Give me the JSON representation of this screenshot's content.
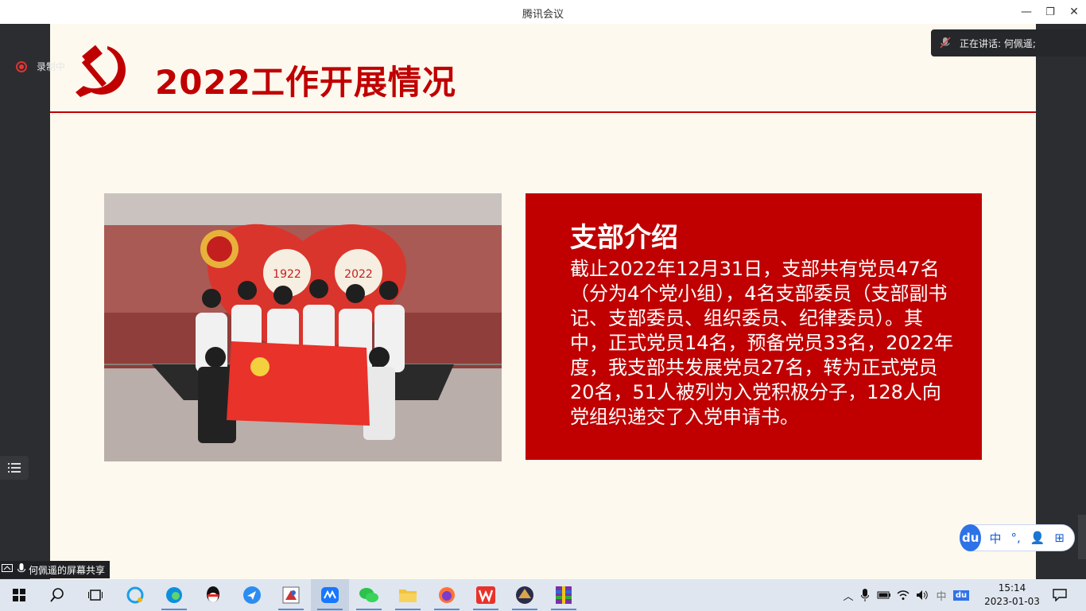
{
  "window": {
    "title": "腾讯会议",
    "minimize": "—",
    "restore": "❐",
    "close": "✕"
  },
  "meeting": {
    "recording": "录制中",
    "speaking": "正在讲话: 何佩遥;",
    "share_label": "何佩遥的屏幕共享"
  },
  "slide": {
    "title": "2022工作开展情况",
    "photo_years": [
      "1922",
      "2022"
    ],
    "info": {
      "heading": "支部介绍",
      "body": "截止2022年12月31日，支部共有党员47名（分为4个党小组），4名支部委员（支部副书记、支部委员、组织委员、纪律委员）。其中，正式党员14名，预备党员33名，2022年度，我支部共发展党员27名，转为正式党员20名，51人被列为入党积极分子，128人向党组织递交了入党申请书。"
    }
  },
  "ime": {
    "logo": "du",
    "items": [
      "中",
      "°,",
      "👤",
      "⊞"
    ]
  },
  "taskbar": {
    "icons": [
      "windows-start-icon",
      "search-icon",
      "task-view-icon",
      "browser-360-icon",
      "edge-icon",
      "qq-icon",
      "feishu-icon",
      "app-icon",
      "tencent-meeting-icon",
      "wechat-icon",
      "file-explorer-icon",
      "firefox-icon",
      "wps-icon",
      "app-game-icon",
      "winrar-icon"
    ],
    "tray": {
      "chevron": "︿",
      "ime_lang": "中",
      "ime_du": "du"
    },
    "time": "15:14",
    "date": "2023-01-03"
  },
  "colors": {
    "party_red": "#c00000",
    "slide_bg": "#fdf9ee",
    "taskbar": "#dfe6ef"
  }
}
